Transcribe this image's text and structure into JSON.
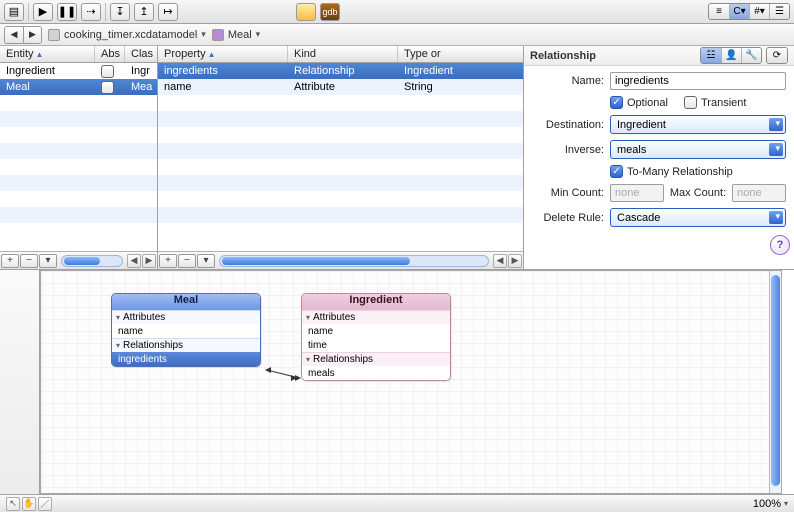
{
  "toolbar": {
    "gdb_label": "gdb"
  },
  "breadcrumb": {
    "file": "cooking_timer.xcdatamodel",
    "entity_prefix": "E",
    "entity": "Meal"
  },
  "entity_panel": {
    "columns": [
      "Entity",
      "Abs",
      "Clas"
    ],
    "rows": [
      {
        "name": "Ingredient",
        "abstract": false,
        "class_short": "Ingr"
      },
      {
        "name": "Meal",
        "abstract": false,
        "class_short": "Mea"
      }
    ],
    "selected_index": 1
  },
  "property_panel": {
    "columns": [
      "Property",
      "Kind",
      "Type or"
    ],
    "rows": [
      {
        "name": "ingredients",
        "kind": "Relationship",
        "type": "Ingredient"
      },
      {
        "name": "name",
        "kind": "Attribute",
        "type": "String"
      }
    ],
    "selected_index": 0
  },
  "inspector": {
    "section_title": "Relationship",
    "name_label": "Name:",
    "name_value": "ingredients",
    "optional_label": "Optional",
    "optional_checked": true,
    "transient_label": "Transient",
    "transient_checked": false,
    "destination_label": "Destination:",
    "destination_value": "Ingredient",
    "inverse_label": "Inverse:",
    "inverse_value": "meals",
    "tomany_label": "To-Many Relationship",
    "tomany_checked": true,
    "mincount_label": "Min Count:",
    "mincount_placeholder": "none",
    "maxcount_label": "Max Count:",
    "maxcount_placeholder": "none",
    "deleterule_label": "Delete Rule:",
    "deleterule_value": "Cascade",
    "help": "?"
  },
  "graph": {
    "meal": {
      "title": "Meal",
      "sections": {
        "attributes_label": "Attributes",
        "attributes": [
          "name"
        ],
        "relationships_label": "Relationships",
        "relationships": [
          "ingredients"
        ]
      },
      "selected_relationship": "ingredients"
    },
    "ingredient": {
      "title": "Ingredient",
      "sections": {
        "attributes_label": "Attributes",
        "attributes": [
          "name",
          "time"
        ],
        "relationships_label": "Relationships",
        "relationships": [
          "meals"
        ]
      }
    }
  },
  "statusbar": {
    "zoom": "100%"
  }
}
